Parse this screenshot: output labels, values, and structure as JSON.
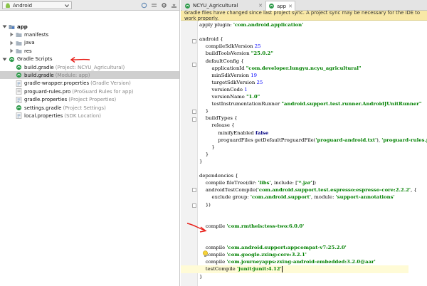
{
  "project_panel": {
    "view_mode": "Android",
    "tree": [
      {
        "label": "app",
        "bold": true,
        "indent": 0,
        "arrow": "down",
        "icon": "folder-module-icon"
      },
      {
        "label": "manifests",
        "indent": 1,
        "arrow": "right",
        "icon": "folder-icon"
      },
      {
        "label": "java",
        "indent": 1,
        "arrow": "right",
        "icon": "folder-icon"
      },
      {
        "label": "res",
        "indent": 1,
        "arrow": "right",
        "icon": "folder-icon"
      },
      {
        "label": "Gradle Scripts",
        "indent": 0,
        "arrow": "down",
        "icon": "gradle-icon"
      },
      {
        "label": "build.gradle",
        "hint": "(Project: NCYU_Agricultural)",
        "indent": 1,
        "icon": "gradle-file-icon"
      },
      {
        "label": "build.gradle",
        "hint": "(Module: app)",
        "indent": 1,
        "icon": "gradle-file-icon",
        "selected": true
      },
      {
        "label": "gradle-wrapper.properties",
        "hint": "(Gradle Version)",
        "indent": 1,
        "icon": "properties-icon"
      },
      {
        "label": "proguard-rules.pro",
        "hint": "(ProGuard Rules for app)",
        "indent": 1,
        "icon": "file-icon"
      },
      {
        "label": "gradle.properties",
        "hint": "(Project Properties)",
        "indent": 1,
        "icon": "properties-icon"
      },
      {
        "label": "settings.gradle",
        "hint": "(Project Settings)",
        "indent": 1,
        "icon": "gradle-file-icon"
      },
      {
        "label": "local.properties",
        "hint": "(SDK Location)",
        "indent": 1,
        "icon": "properties-icon"
      }
    ]
  },
  "tabs": [
    {
      "label": "NCYU_Agricultural",
      "icon": "gradle-icon"
    },
    {
      "label": "app",
      "icon": "gradle-icon",
      "active": true
    }
  ],
  "banner": "Gradle files have changed since last project sync. A project sync may be necessary for the IDE to work properly.",
  "code": [
    "apply plugin: 'com.android.application'",
    "",
    "android {",
    "    compileSdkVersion 25",
    "    buildToolsVersion \"25.0.2\"",
    "    defaultConfig {",
    "        applicationId \"com.developer.lungyu.ncyu_agricultural\"",
    "        minSdkVersion 19",
    "        targetSdkVersion 25",
    "        versionCode 1",
    "        versionName \"1.0\"",
    "        testInstrumentationRunner \"android.support.test.runner.AndroidJUnitRunner\"",
    "    }",
    "    buildTypes {",
    "        release {",
    "            minifyEnabled false",
    "            proguardFiles getDefaultProguardFile('proguard-android.txt'), 'proguard-rules.pro'",
    "        }",
    "    }",
    "}",
    "",
    "dependencies {",
    "    compile fileTree(dir: 'libs', include: ['*.jar'])",
    "    androidTestCompile('com.android.support.test.espresso:espresso-core:2.2.2', {",
    "        exclude group: 'com.android.support', module: 'support-annotations'",
    "    })",
    "",
    "",
    "    compile 'com.rmtheis:tess-two:6.0.0'",
    "",
    "",
    "    compile 'com.android.support:appcompat-v7:25.2.0'",
    "    compile 'com.google.zxing:core:3.2.1'",
    "    compile 'com.journeyapps:zxing-android-embedded:3.2.0@aar'",
    "    testCompile 'junit:junit:4.12'",
    "}"
  ],
  "colors": {
    "annotation_red": "#e8201a",
    "keyword": "#000080",
    "string": "#008000",
    "number": "#0000ff",
    "banner_bg": "#f8e8a6",
    "selected_row": "#cfcfcf"
  }
}
